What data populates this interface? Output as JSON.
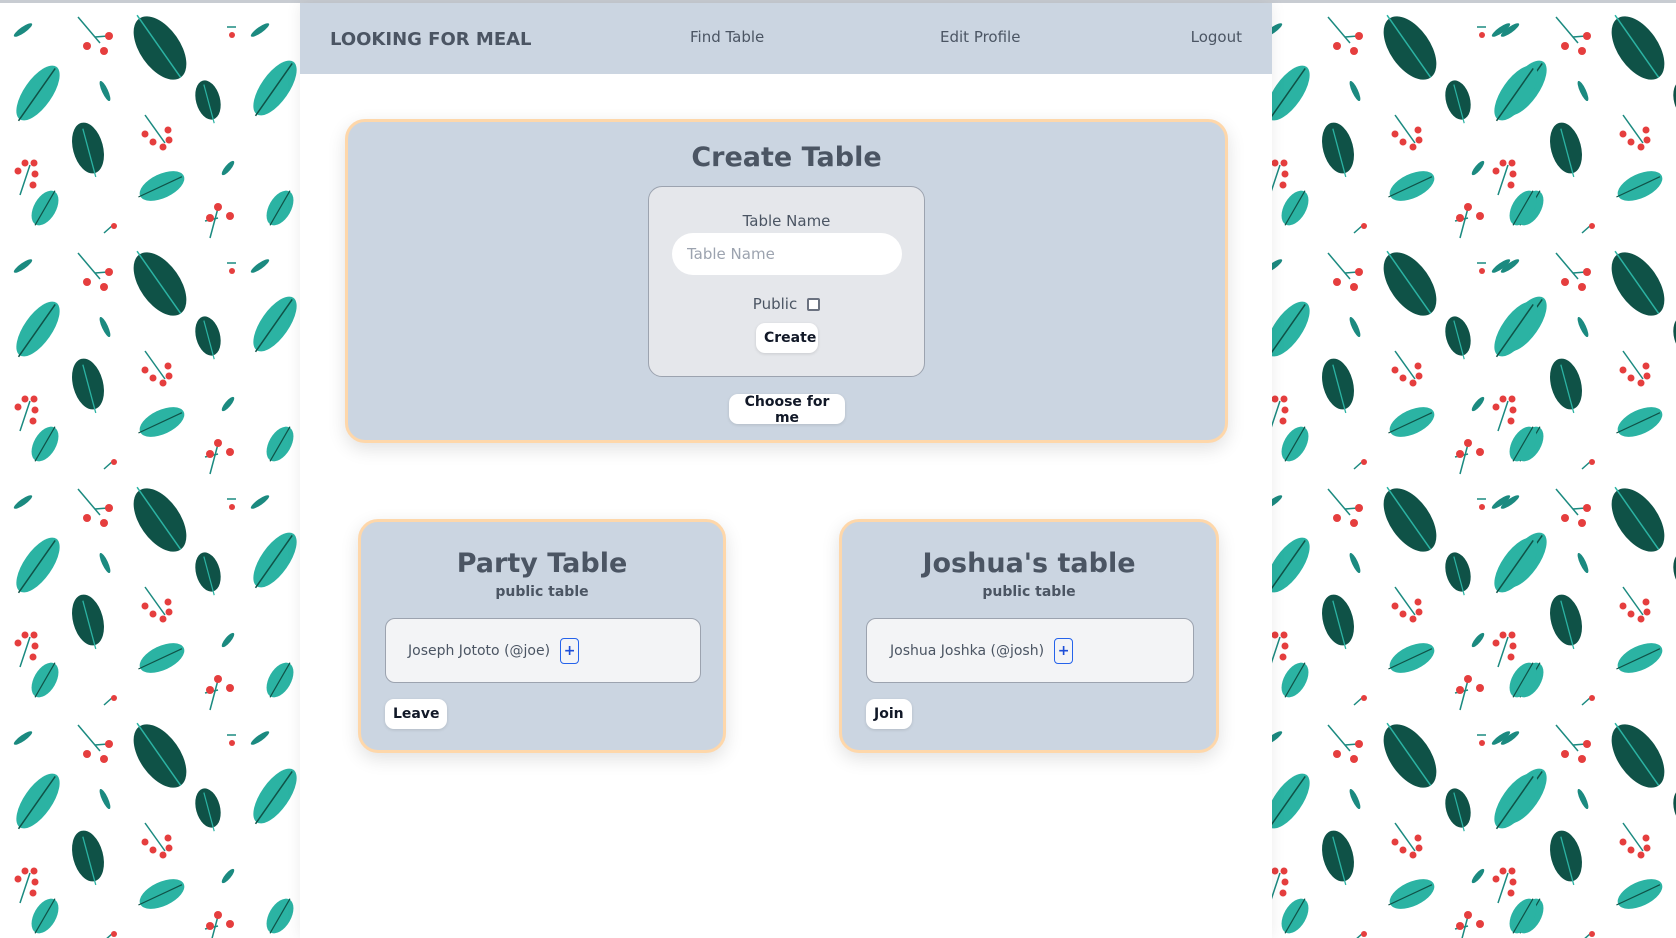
{
  "navbar": {
    "brand": "LOOKING FOR MEAL",
    "links": [
      "Find Table",
      "Edit Profile",
      "Logout"
    ]
  },
  "create_table": {
    "title": "Create Table",
    "name_label": "Table Name",
    "name_value": "",
    "name_placeholder": "Table Name",
    "public_label": "Public",
    "public_checked": false,
    "create_button": "Create",
    "choose_button": "Choose for me"
  },
  "tables": [
    {
      "name": "Party Table",
      "visibility": "public table",
      "members": [
        "Joseph Jototo (@joe)"
      ],
      "add_icon": "plus",
      "action": "Leave"
    },
    {
      "name": "Joshua's table",
      "visibility": "public table",
      "members": [
        "Joshua Joshka (@josh)"
      ],
      "add_icon": "plus",
      "action": "Join"
    }
  ],
  "colors": {
    "navbar_bg": "#cbd5e1",
    "card_bg": "#cbd5e1",
    "card_border": "#fed7aa",
    "text": "#4b5563",
    "plus_accent": "#2563eb",
    "leaf_light": "#2bb3a3",
    "leaf_dark": "#0f5247",
    "berry": "#e53e3e"
  }
}
